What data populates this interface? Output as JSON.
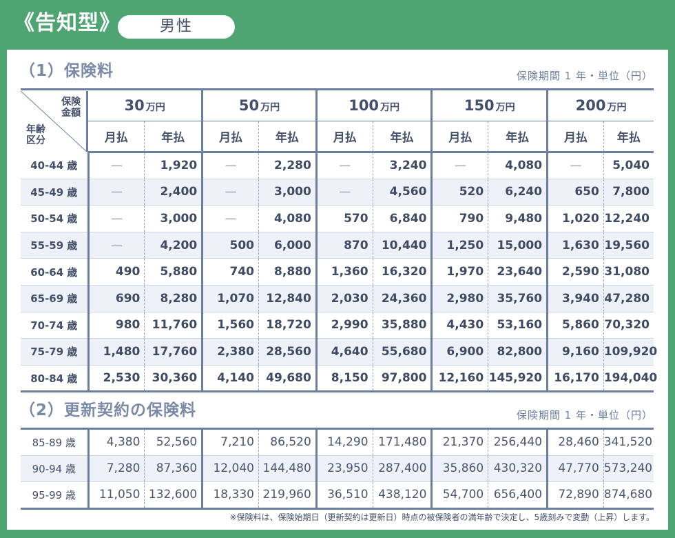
{
  "header": {
    "type_title": "《告知型》",
    "gender": "男性"
  },
  "section1": {
    "title": "（1）保険料",
    "unit_note": "保険期間 1 年・単位（円）",
    "corner_amount": "保険\n金額",
    "corner_age": "年齢\n区分",
    "amounts": [
      {
        "num": "30",
        "unit": "万円"
      },
      {
        "num": "50",
        "unit": "万円"
      },
      {
        "num": "100",
        "unit": "万円"
      },
      {
        "num": "150",
        "unit": "万円"
      },
      {
        "num": "200",
        "unit": "万円"
      }
    ],
    "monthly_label": "月払",
    "yearly_label": "年払",
    "rows": [
      {
        "age": "40-44 歳",
        "cells": [
          "—",
          "1,920",
          "—",
          "2,280",
          "—",
          "3,240",
          "—",
          "4,080",
          "—",
          "5,040"
        ]
      },
      {
        "age": "45-49 歳",
        "cells": [
          "—",
          "2,400",
          "—",
          "3,000",
          "—",
          "4,560",
          "520",
          "6,240",
          "650",
          "7,800"
        ]
      },
      {
        "age": "50-54 歳",
        "cells": [
          "—",
          "3,000",
          "—",
          "4,080",
          "570",
          "6,840",
          "790",
          "9,480",
          "1,020",
          "12,240"
        ]
      },
      {
        "age": "55-59 歳",
        "cells": [
          "—",
          "4,200",
          "500",
          "6,000",
          "870",
          "10,440",
          "1,250",
          "15,000",
          "1,630",
          "19,560"
        ]
      },
      {
        "age": "60-64 歳",
        "cells": [
          "490",
          "5,880",
          "740",
          "8,880",
          "1,360",
          "16,320",
          "1,970",
          "23,640",
          "2,590",
          "31,080"
        ]
      },
      {
        "age": "65-69 歳",
        "cells": [
          "690",
          "8,280",
          "1,070",
          "12,840",
          "2,030",
          "24,360",
          "2,980",
          "35,760",
          "3,940",
          "47,280"
        ]
      },
      {
        "age": "70-74 歳",
        "cells": [
          "980",
          "11,760",
          "1,560",
          "18,720",
          "2,990",
          "35,880",
          "4,430",
          "53,160",
          "5,860",
          "70,320"
        ]
      },
      {
        "age": "75-79 歳",
        "cells": [
          "1,480",
          "17,760",
          "2,380",
          "28,560",
          "4,640",
          "55,680",
          "6,900",
          "82,800",
          "9,160",
          "109,920"
        ]
      },
      {
        "age": "80-84 歳",
        "cells": [
          "2,530",
          "30,360",
          "4,140",
          "49,680",
          "8,150",
          "97,800",
          "12,160",
          "145,920",
          "16,170",
          "194,040"
        ]
      }
    ]
  },
  "section2": {
    "title": "（2）更新契約の保険料",
    "unit_note": "保険期間 1 年・単位（円）",
    "rows": [
      {
        "age": "85-89 歳",
        "cells": [
          "4,380",
          "52,560",
          "7,210",
          "86,520",
          "14,290",
          "171,480",
          "21,370",
          "256,440",
          "28,460",
          "341,520"
        ]
      },
      {
        "age": "90-94 歳",
        "cells": [
          "7,280",
          "87,360",
          "12,040",
          "144,480",
          "23,950",
          "287,400",
          "35,860",
          "430,320",
          "47,770",
          "573,240"
        ]
      },
      {
        "age": "95-99 歳",
        "cells": [
          "11,050",
          "132,600",
          "18,330",
          "219,960",
          "36,510",
          "438,120",
          "54,700",
          "656,400",
          "72,890",
          "874,680"
        ]
      }
    ]
  },
  "footnote": "※保険料は、保険始期日（更新契約は更新日）時点の被保険者の満年齢で決定し、5歳刻みで変動（上昇）します。"
}
